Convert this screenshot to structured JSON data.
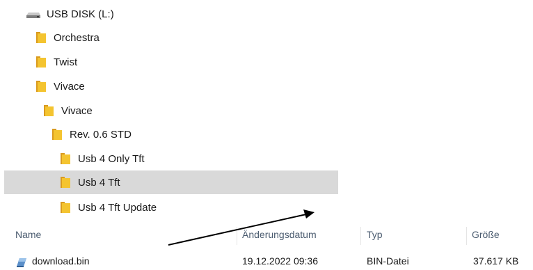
{
  "tree": {
    "items": [
      {
        "label": "USB DISK (L:)",
        "icon": "usb-drive-icon"
      },
      {
        "label": "Orchestra",
        "icon": "folder-icon"
      },
      {
        "label": "Twist",
        "icon": "folder-icon"
      },
      {
        "label": "Vivace",
        "icon": "folder-icon"
      },
      {
        "label": "Vivace",
        "icon": "folder-icon"
      },
      {
        "label": "Rev. 0.6 STD",
        "icon": "folder-icon"
      },
      {
        "label": "Usb 4 Only Tft",
        "icon": "folder-icon"
      },
      {
        "label": "Usb 4 Tft",
        "icon": "folder-icon",
        "selected": true
      },
      {
        "label": "Usb 4 Tft Update",
        "icon": "folder-icon"
      }
    ]
  },
  "columns": {
    "name": "Name",
    "modified": "Änderungsdatum",
    "type": "Typ",
    "size": "Größe"
  },
  "files": [
    {
      "name": "download.bin",
      "modified": "19.12.2022 09:36",
      "type": "BIN-Datei",
      "size": "37.617 KB",
      "icon": "bin-file-icon"
    }
  ],
  "colors": {
    "selection": "#d9d9d9",
    "folder": "#f4c430",
    "header_text": "#4a5b6f"
  }
}
